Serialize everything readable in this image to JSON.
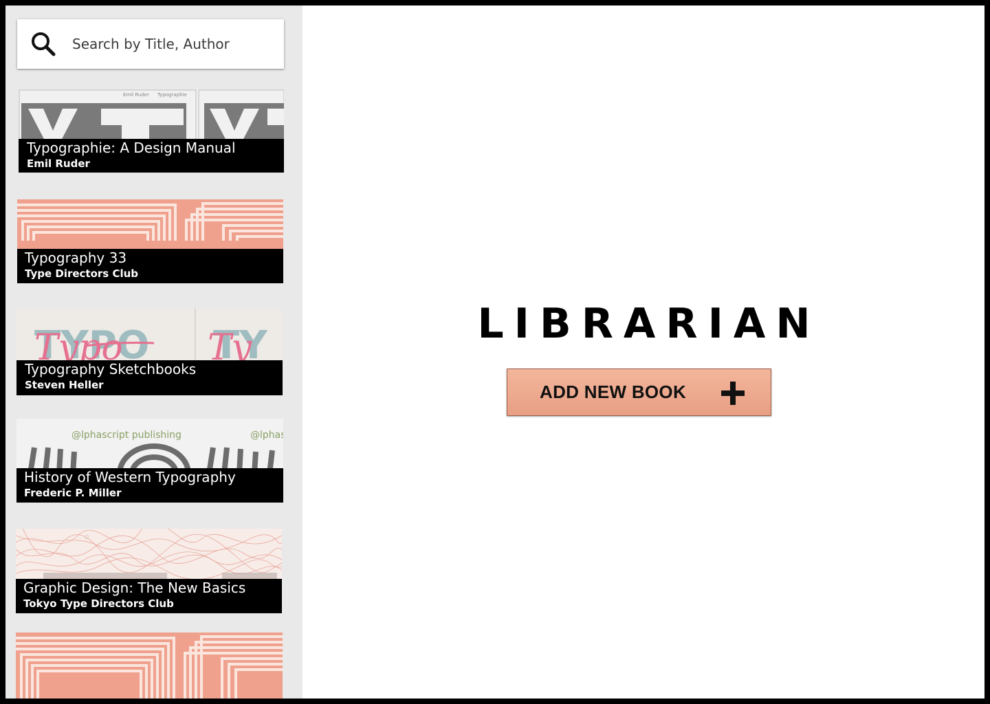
{
  "search": {
    "placeholder": "Search by Title, Author"
  },
  "books": [
    {
      "title": "Typographie: A Design Manual",
      "author": "Emil Ruder",
      "cover_text": [
        "Emil Ruder",
        "Typographie"
      ]
    },
    {
      "title": "Typography 33",
      "author": "Type Directors Club"
    },
    {
      "title": "Typography Sketchbooks",
      "author": "Steven Heller",
      "cover_text": [
        "TYPO",
        "Typo"
      ]
    },
    {
      "title": "History of Western Typography",
      "author": "Frederic P. Miller",
      "cover_text": [
        "@lphascript publishing",
        "@lphas"
      ]
    },
    {
      "title": "Graphic Design: The New Basics",
      "author": "Tokyo Type Directors Club"
    },
    {
      "title": "",
      "author": ""
    }
  ],
  "main": {
    "logo": "LIBRARIAN",
    "add_button_label": "ADD NEW BOOK"
  },
  "colors": {
    "sidebar_bg": "#e9e9e9",
    "button_accent": "#efab90",
    "caption_bg": "#000000"
  },
  "icons": [
    "search-icon",
    "plus-icon"
  ]
}
